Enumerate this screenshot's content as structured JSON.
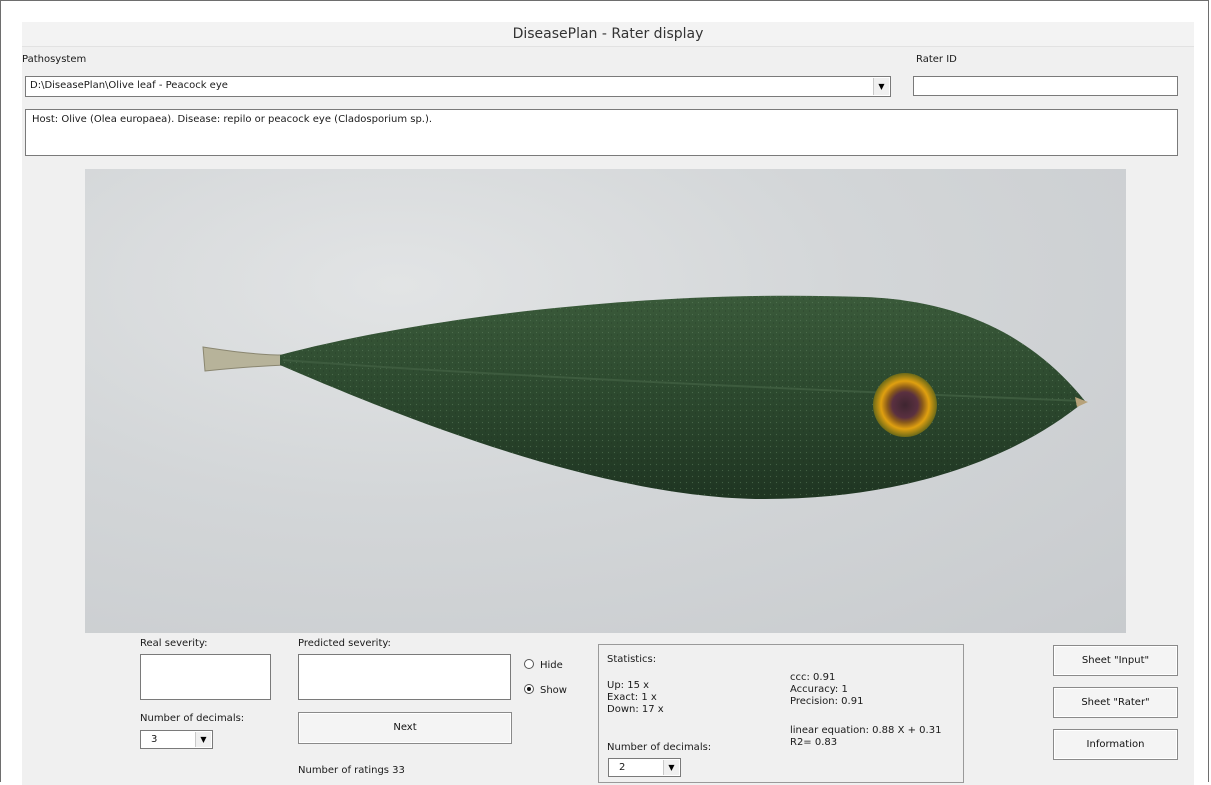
{
  "window": {
    "title": "DiseasePlan - Rater display"
  },
  "pathosystem": {
    "label": "Pathosystem",
    "value": "D:\\DiseasePlan\\Olive leaf - Peacock eye"
  },
  "rater": {
    "label": "Rater ID",
    "value": ""
  },
  "host_description": "Host: Olive (Olea europaea). Disease: repilo or peacock eye (Cladosporium sp.).",
  "real_severity": {
    "label": "Real severity:",
    "value": "",
    "decimals_label": "Number of decimals:",
    "decimals_value": "3"
  },
  "predicted_severity": {
    "label": "Predicted severity:",
    "value": "",
    "next_label": "Next",
    "ratings_count_text": "Number of ratings 33"
  },
  "visibility": {
    "hide_label": "Hide",
    "show_label": "Show",
    "selected": "Show"
  },
  "statistics": {
    "title": "Statistics:",
    "up": "Up: 15 x",
    "exact": "Exact: 1 x",
    "down": "Down: 17 x",
    "ccc": "ccc:  0.91",
    "accuracy": "Accuracy: 1",
    "precision": "Precision: 0.91",
    "linear_equation": "linear equation: 0.88 X + 0.31",
    "r2": "R2= 0.83",
    "decimals_label": "Number of decimals:",
    "decimals_value": "2"
  },
  "buttons": {
    "sheet_input": "Sheet \"Input\"",
    "sheet_rater": "Sheet \"Rater\"",
    "information": "Information"
  },
  "colors": {
    "window_bg": "#f0f0f0",
    "leaf_green": "#2f4a30",
    "lesion_yellow": "#d99a12",
    "lesion_center": "#4a2a35"
  },
  "icons": {
    "dropdown": "chevron-down-icon",
    "radio": "radio-icon"
  }
}
